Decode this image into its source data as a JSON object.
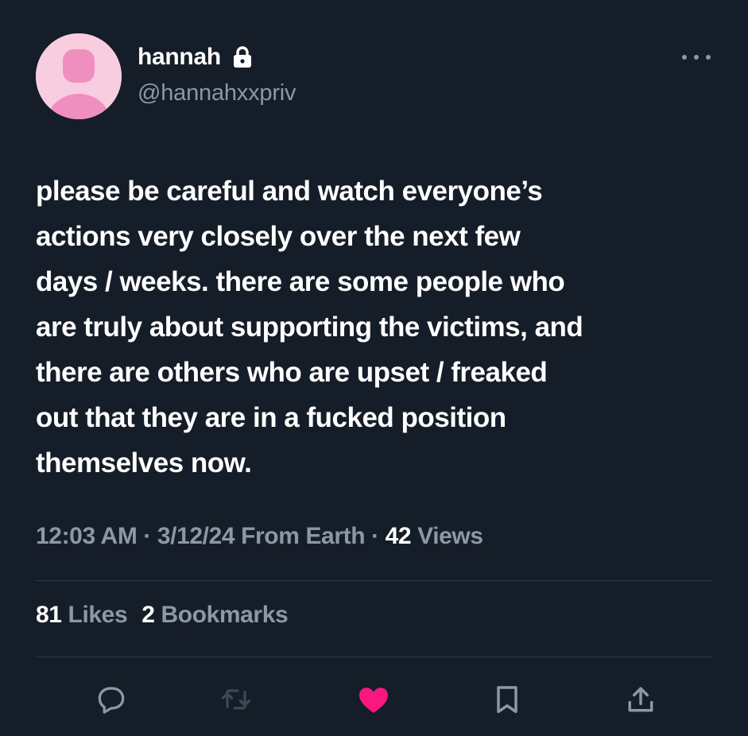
{
  "author": {
    "display_name": "hannah",
    "handle": "@hannahxxpriv",
    "protected": true
  },
  "tweet": {
    "text": "please be careful and watch everyone’s\nactions very closely over the next few\ndays / weeks. there are some people who\nare truly about supporting the victims, and\nthere are others who are upset / freaked\nout that they are in a fucked position\nthemselves now."
  },
  "meta": {
    "time": "12:03 AM",
    "sep1": " · ",
    "date": "3/12/24",
    "source": " From Earth",
    "sep2": " · ",
    "views_count": "42",
    "views_label": " Views"
  },
  "stats": {
    "likes_count": "81",
    "likes_label": " Likes",
    "bookmarks_count": "2",
    "bookmarks_label": " Bookmarks"
  },
  "actions": {
    "reply_icon": "reply-icon",
    "retweet_icon": "retweet-icon",
    "like_icon": "heart-icon",
    "bookmark_icon": "bookmark-icon",
    "share_icon": "share-icon"
  },
  "colors": {
    "background": "#151d28",
    "like_active": "#f91880",
    "secondary_text": "#8b98a5",
    "avatar_bg": "#f9cde0",
    "avatar_fg": "#f08ec0"
  }
}
